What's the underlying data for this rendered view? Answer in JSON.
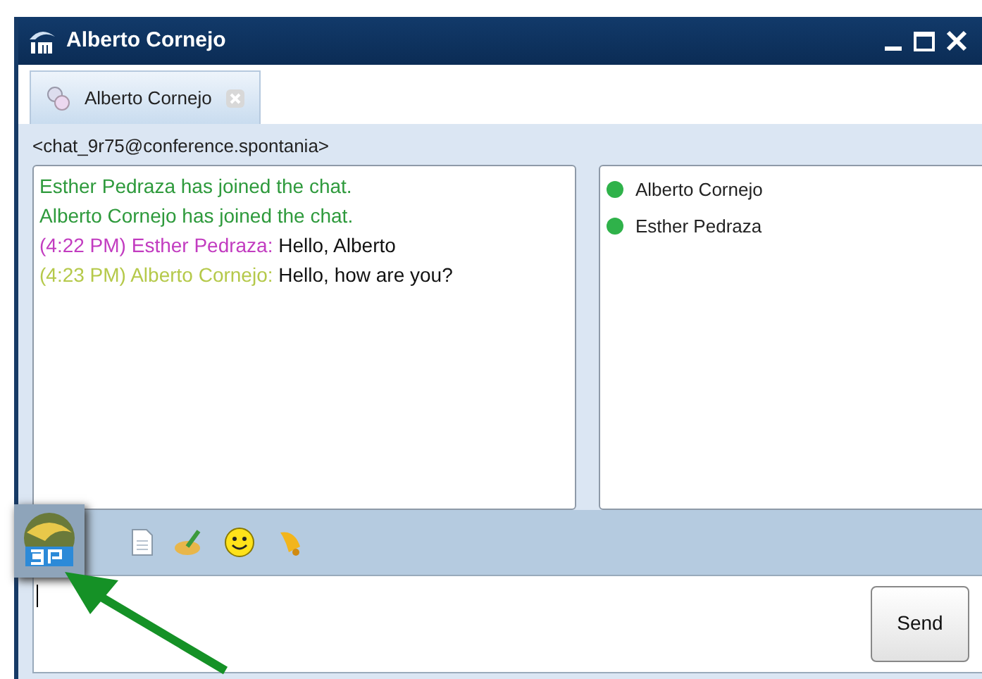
{
  "window": {
    "title": "Alberto Cornejo"
  },
  "tabs": [
    {
      "label": "Alberto Cornejo",
      "selected": true
    }
  ],
  "room_address": "<chat_9r75@conference.spontania>",
  "messages": [
    {
      "kind": "system",
      "text": "Esther Pedraza has joined the chat.",
      "color": "#2e9a3c"
    },
    {
      "kind": "system",
      "text": "Alberto Cornejo has joined the chat.",
      "color": "#2e9a3c"
    },
    {
      "kind": "message",
      "prefix": "(4:22 PM) Esther Pedraza:",
      "text": "Hello, Alberto",
      "color": "#c23cc0"
    },
    {
      "kind": "message",
      "prefix": "(4:23 PM) Alberto Cornejo:",
      "text": "Hello, how are you?",
      "color": "#b5c94a"
    }
  ],
  "participants": [
    {
      "name": "Alberto Cornejo",
      "color": "#2fb24a"
    },
    {
      "name": "Esther Pedraza",
      "color": "#2fb24a"
    }
  ],
  "send_button": "Send"
}
